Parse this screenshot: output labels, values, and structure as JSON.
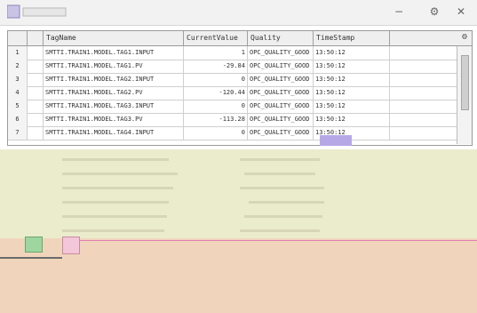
{
  "window": {
    "minimize_icon": "minimize-icon",
    "settings_icon": "gear-icon",
    "close_icon": "close-icon"
  },
  "grid": {
    "columns": [
      {
        "key": "tagname",
        "label": "TagName"
      },
      {
        "key": "current_value",
        "label": "CurrentValue"
      },
      {
        "key": "quality",
        "label": "Quality"
      },
      {
        "key": "time_stamp",
        "label": "TimeStamp"
      }
    ],
    "rows": [
      {
        "idx": "1",
        "tagname": "SMTTI.TRAIN1.MODEL.TAG1.INPUT",
        "current_value": "1",
        "quality": "OPC_QUALITY_GOOD",
        "time_stamp": "13:50:12"
      },
      {
        "idx": "2",
        "tagname": "SMTTI.TRAIN1.MODEL.TAG1.PV",
        "current_value": "-29.84",
        "quality": "OPC_QUALITY_GOOD",
        "time_stamp": "13:50:12"
      },
      {
        "idx": "3",
        "tagname": "SMTTI.TRAIN1.MODEL.TAG2.INPUT",
        "current_value": "0",
        "quality": "OPC_QUALITY_GOOD",
        "time_stamp": "13:50:12"
      },
      {
        "idx": "4",
        "tagname": "SMTTI.TRAIN1.MODEL.TAG2.PV",
        "current_value": "-120.44",
        "quality": "OPC_QUALITY_GOOD",
        "time_stamp": "13:50:12"
      },
      {
        "idx": "5",
        "tagname": "SMTTI.TRAIN1.MODEL.TAG3.INPUT",
        "current_value": "0",
        "quality": "OPC_QUALITY_GOOD",
        "time_stamp": "13:50:12"
      },
      {
        "idx": "6",
        "tagname": "SMTTI.TRAIN1.MODEL.TAG3.PV",
        "current_value": "-113.28",
        "quality": "OPC_QUALITY_GOOD",
        "time_stamp": "13:50:12"
      },
      {
        "idx": "7",
        "tagname": "SMTTI.TRAIN1.MODEL.TAG4.INPUT",
        "current_value": "0",
        "quality": "OPC_QUALITY_GOOD",
        "time_stamp": "13:50:12"
      }
    ]
  }
}
